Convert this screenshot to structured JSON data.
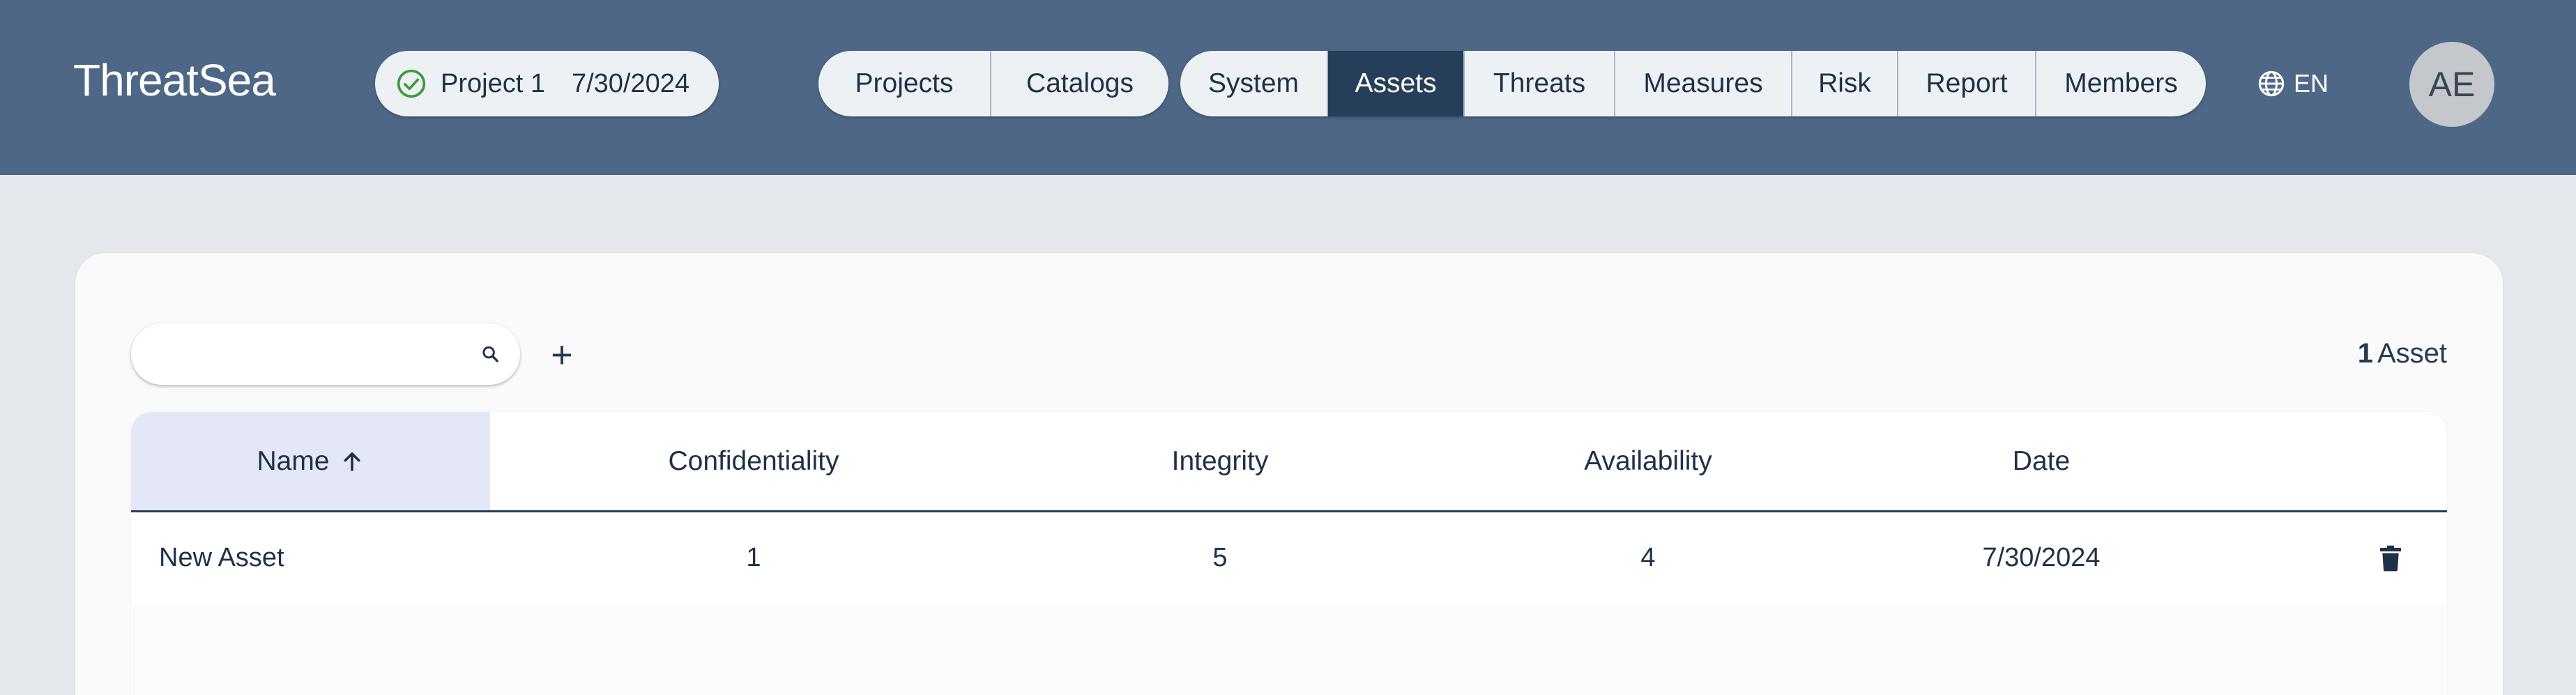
{
  "header": {
    "logo": "ThreatSea",
    "project": {
      "name": "Project 1",
      "date": "7/30/2024"
    },
    "nav_group1": [
      {
        "label": "Projects"
      },
      {
        "label": "Catalogs"
      }
    ],
    "nav_group2": [
      {
        "label": "System"
      },
      {
        "label": "Assets",
        "active": true
      },
      {
        "label": "Threats"
      },
      {
        "label": "Measures"
      },
      {
        "label": "Risk"
      },
      {
        "label": "Report"
      },
      {
        "label": "Members"
      }
    ],
    "language": "EN",
    "avatar_initials": "AE"
  },
  "toolbar": {
    "search_value": "",
    "add_label": "+",
    "count": "1",
    "count_label": "Asset"
  },
  "table": {
    "columns": [
      "Name",
      "Confidentiality",
      "Integrity",
      "Availability",
      "Date"
    ],
    "sorted_column": "Name",
    "sort_direction": "ascending",
    "rows": [
      {
        "name": "New Asset",
        "confidentiality": "1",
        "integrity": "5",
        "availability": "4",
        "date": "7/30/2024"
      }
    ]
  },
  "colors": {
    "header_bg": "#4f6787",
    "active_tab": "#253f5a",
    "page_bg": "#e4e8ed",
    "sorted_header_bg": "#e4e7f5",
    "check_green": "#3a9a3a"
  },
  "icons": [
    "check-circle-icon",
    "globe-icon",
    "search-icon",
    "plus-icon",
    "arrow-up-icon",
    "trash-icon"
  ]
}
